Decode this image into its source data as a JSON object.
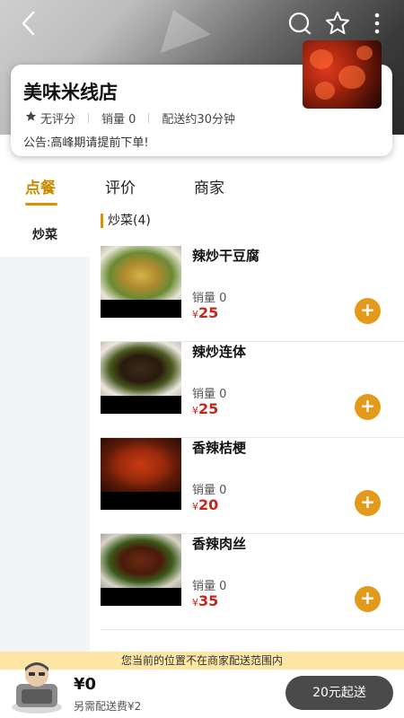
{
  "header": {
    "icons": [
      "back-icon",
      "search-icon",
      "star-icon",
      "more-icon"
    ]
  },
  "shop": {
    "name": "美味米线店",
    "rating": "无评分",
    "sales": "销量 0",
    "delivery": "配送约30分钟",
    "notice": "公告:高峰期请提前下单!"
  },
  "tabs": [
    {
      "label": "点餐",
      "active": true
    },
    {
      "label": "评价",
      "active": false
    },
    {
      "label": "商家",
      "active": false
    }
  ],
  "categories": [
    {
      "label": "炒菜",
      "active": true
    }
  ],
  "section": {
    "title": "炒菜(4)"
  },
  "items": [
    {
      "name": "辣炒干豆腐",
      "sales": "销量 0",
      "currency": "¥",
      "price": "25"
    },
    {
      "name": "辣炒连体",
      "sales": "销量 0",
      "currency": "¥",
      "price": "25"
    },
    {
      "name": "香辣桔梗",
      "sales": "销量 0",
      "currency": "¥",
      "price": "20"
    },
    {
      "name": "香辣肉丝",
      "sales": "销量 0",
      "currency": "¥",
      "price": "35"
    }
  ],
  "add_label": "+",
  "warning": "您当前的位置不在商家配送范围内",
  "cart": {
    "total": "¥0",
    "fee": "另需配送费¥2",
    "checkout": "20元起送"
  },
  "colors": {
    "accent": "#d99400",
    "price": "#c7261b",
    "add_button": "#e39a1a",
    "warning_bg": "#fbe6a5",
    "checkout_bg": "#4a4a4a"
  }
}
